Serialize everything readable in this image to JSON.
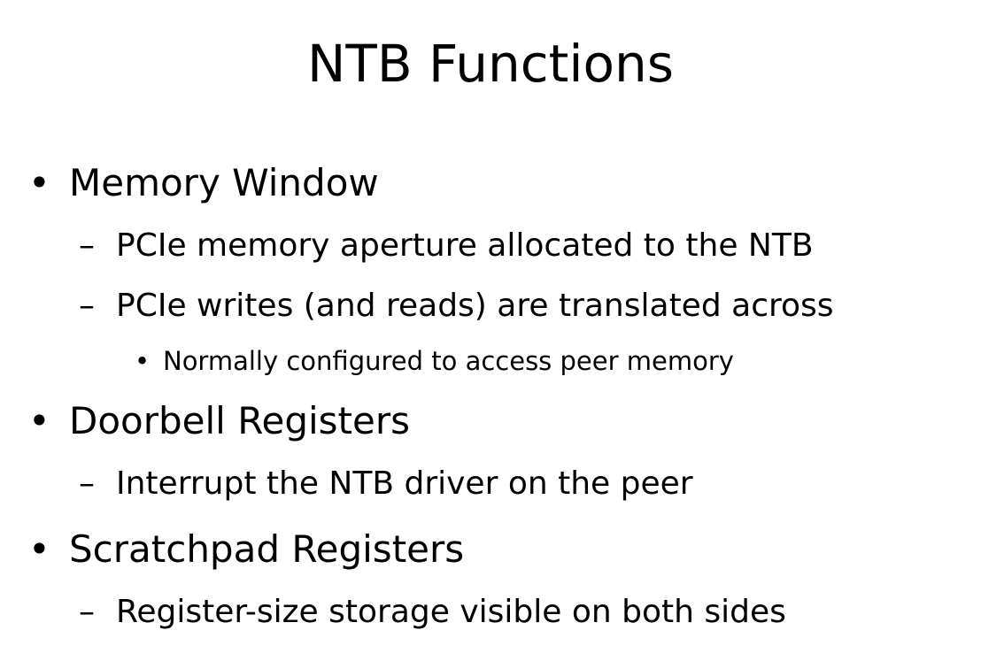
{
  "slide": {
    "title": "NTB Functions",
    "items": [
      {
        "level": 1,
        "marker": "•",
        "text": "Memory Window"
      },
      {
        "level": 2,
        "marker": "–",
        "text": "PCIe memory aperture allocated to the NTB"
      },
      {
        "level": 2,
        "marker": "–",
        "text": "PCIe writes (and reads) are translated across"
      },
      {
        "level": 3,
        "marker": "•",
        "text": "Normally configured to access peer memory"
      },
      {
        "level": 1,
        "marker": "•",
        "text": "Doorbell Registers"
      },
      {
        "level": 2,
        "marker": "–",
        "text": "Interrupt the NTB driver on the peer"
      },
      {
        "level": 1,
        "marker": "•",
        "text": "Scratchpad Registers"
      },
      {
        "level": 2,
        "marker": "–",
        "text": "Register-size storage visible on both sides"
      }
    ]
  }
}
